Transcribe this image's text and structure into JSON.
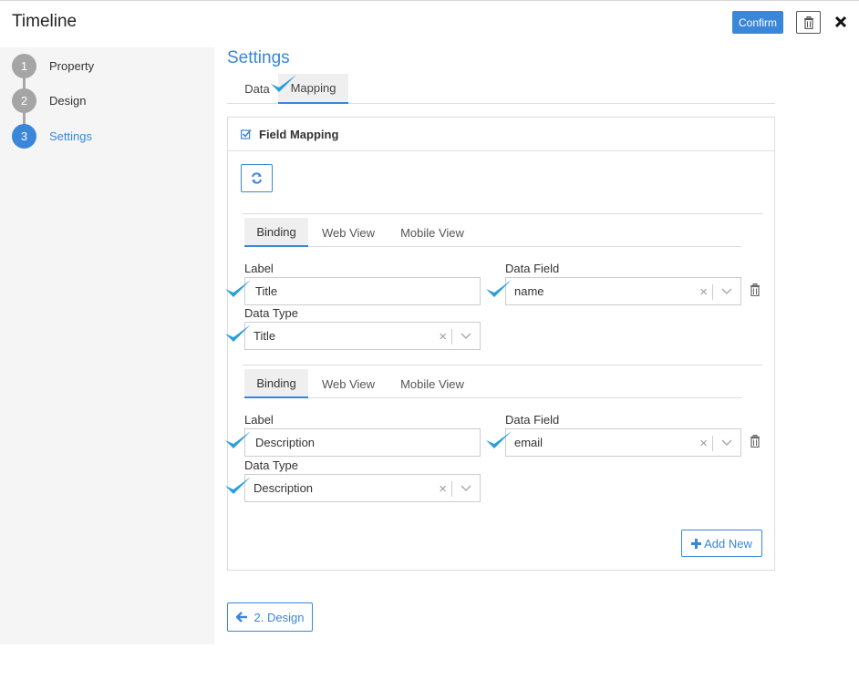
{
  "header": {
    "title": "Timeline",
    "confirm_label": "Confirm",
    "trash_icon": "trash-icon",
    "close_icon": "close-icon"
  },
  "steps": [
    {
      "number": "1",
      "label": "Property",
      "active": false
    },
    {
      "number": "2",
      "label": "Design",
      "active": false
    },
    {
      "number": "3",
      "label": "Settings",
      "active": true
    }
  ],
  "main": {
    "title": "Settings",
    "tabs": [
      {
        "label": "Data",
        "active": false
      },
      {
        "label": "Mapping",
        "active": true
      }
    ]
  },
  "panel": {
    "heading": "Field Mapping",
    "heading_icon": "checkbox-icon",
    "refresh_icon": "refresh-icon",
    "mappings": [
      {
        "tabs": [
          "Binding",
          "Web View",
          "Mobile View"
        ],
        "active_tab": "Binding",
        "label_caption": "Label",
        "label_value": "Title",
        "data_field_caption": "Data Field",
        "data_field_value": "name",
        "data_type_caption": "Data Type",
        "data_type_value": "Title"
      },
      {
        "tabs": [
          "Binding",
          "Web View",
          "Mobile View"
        ],
        "active_tab": "Binding",
        "label_caption": "Label",
        "label_value": "Description",
        "data_field_caption": "Data Field",
        "data_field_value": "email",
        "data_type_caption": "Data Type",
        "data_type_value": "Description"
      }
    ],
    "add_new_label": "Add New",
    "clear_glyph": "×"
  },
  "footer": {
    "back_label": "2. Design"
  },
  "colors": {
    "accent": "#3a86d9",
    "checkmark": "#2a9fd8",
    "sidebar_bg": "#f5f5f5"
  }
}
